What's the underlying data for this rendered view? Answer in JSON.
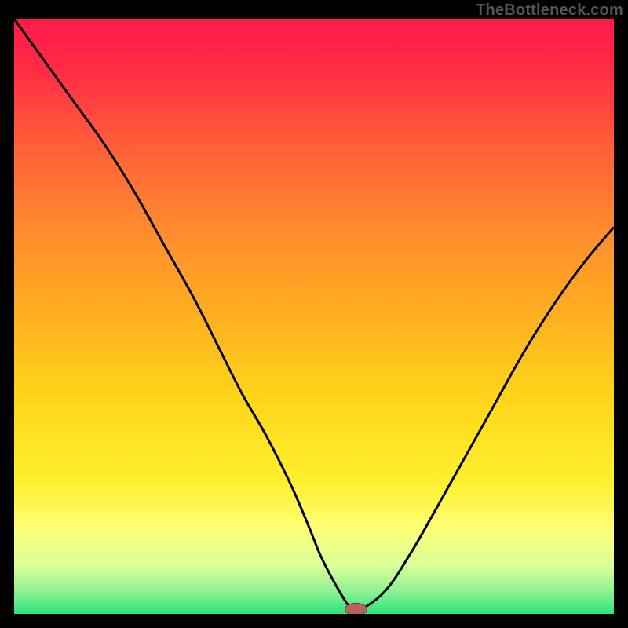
{
  "watermark": "TheBottleneck.com",
  "accent_colors": {
    "black": "#000000",
    "curve": "#000000",
    "marker_fill": "#bb6060",
    "marker_stroke": "#7a3a3a"
  },
  "gradient_stops": [
    {
      "offset": 0.0,
      "color": "#ff1a4a"
    },
    {
      "offset": 0.08,
      "color": "#ff2a45"
    },
    {
      "offset": 0.2,
      "color": "#ff5a3a"
    },
    {
      "offset": 0.35,
      "color": "#ff8a30"
    },
    {
      "offset": 0.5,
      "color": "#ffb020"
    },
    {
      "offset": 0.65,
      "color": "#ffd81a"
    },
    {
      "offset": 0.78,
      "color": "#fff030"
    },
    {
      "offset": 0.86,
      "color": "#fdff7a"
    },
    {
      "offset": 0.92,
      "color": "#d8ff9a"
    },
    {
      "offset": 0.965,
      "color": "#8af090"
    },
    {
      "offset": 1.0,
      "color": "#29e47a"
    }
  ],
  "chart_data": {
    "type": "line",
    "title": "",
    "xlabel": "",
    "ylabel": "",
    "xlim": [
      0,
      100
    ],
    "ylim": [
      0,
      100
    ],
    "grid": false,
    "legend": false,
    "series": [
      {
        "name": "bottleneck-curve",
        "x": [
          0,
          5,
          10,
          15,
          20,
          25,
          30,
          34,
          38,
          42,
          46,
          49,
          51,
          53,
          55,
          56,
          57,
          58,
          62,
          66,
          70,
          75,
          80,
          85,
          90,
          95,
          100
        ],
        "y": [
          100,
          93,
          86,
          79,
          71,
          62,
          53,
          45,
          37,
          30,
          22,
          15,
          10,
          6,
          2.5,
          1.2,
          0.8,
          0.8,
          4,
          10,
          17,
          26,
          35,
          44,
          52,
          59,
          65
        ]
      }
    ],
    "marker": {
      "x": 57,
      "y": 0.8,
      "rx": 1.8,
      "ry": 1.0
    }
  }
}
